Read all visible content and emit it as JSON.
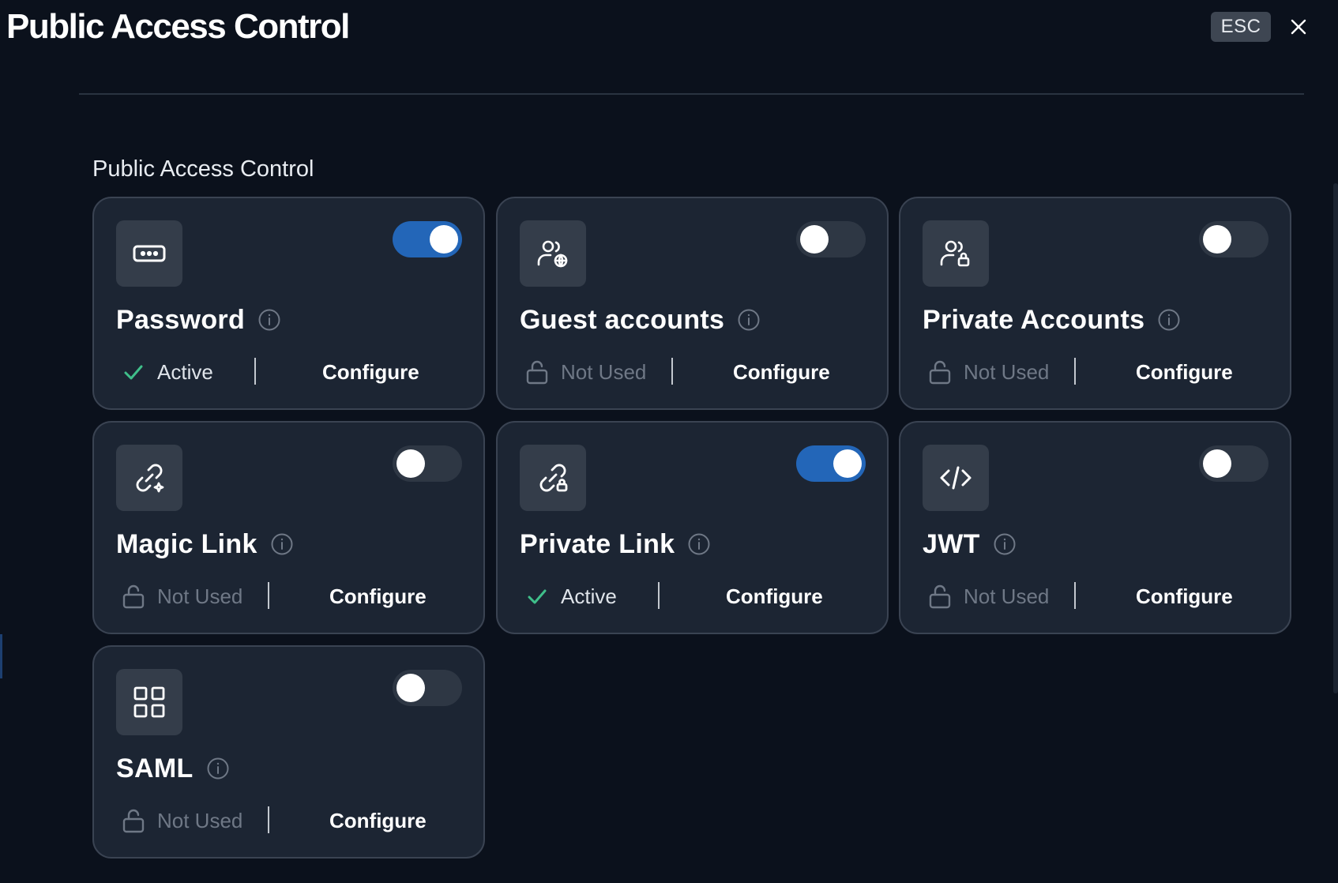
{
  "header": {
    "title": "Public Access Control",
    "esc_label": "ESC"
  },
  "section": {
    "title": "Public Access Control"
  },
  "cards": [
    {
      "name": "Password",
      "enabled": true,
      "status": "Active",
      "configure_label": "Configure",
      "icon": "password-dots-icon"
    },
    {
      "name": "Guest accounts",
      "enabled": false,
      "status": "Not Used",
      "configure_label": "Configure",
      "icon": "user-globe-icon"
    },
    {
      "name": "Private Accounts",
      "enabled": false,
      "status": "Not Used",
      "configure_label": "Configure",
      "icon": "user-lock-icon"
    },
    {
      "name": "Magic Link",
      "enabled": false,
      "status": "Not Used",
      "configure_label": "Configure",
      "icon": "link-sparkle-icon"
    },
    {
      "name": "Private Link",
      "enabled": true,
      "status": "Active",
      "configure_label": "Configure",
      "icon": "link-lock-icon"
    },
    {
      "name": "JWT",
      "enabled": false,
      "status": "Not Used",
      "configure_label": "Configure",
      "icon": "code-icon"
    },
    {
      "name": "SAML",
      "enabled": false,
      "status": "Not Used",
      "configure_label": "Configure",
      "icon": "grid-icon"
    }
  ],
  "colors": {
    "background": "#0b111c",
    "card": "#1c2533",
    "card_border": "#3a4352",
    "toggle_on": "#2366b8",
    "toggle_off": "#2e3744",
    "active_check": "#3fbf8a",
    "muted": "#6f7886"
  }
}
